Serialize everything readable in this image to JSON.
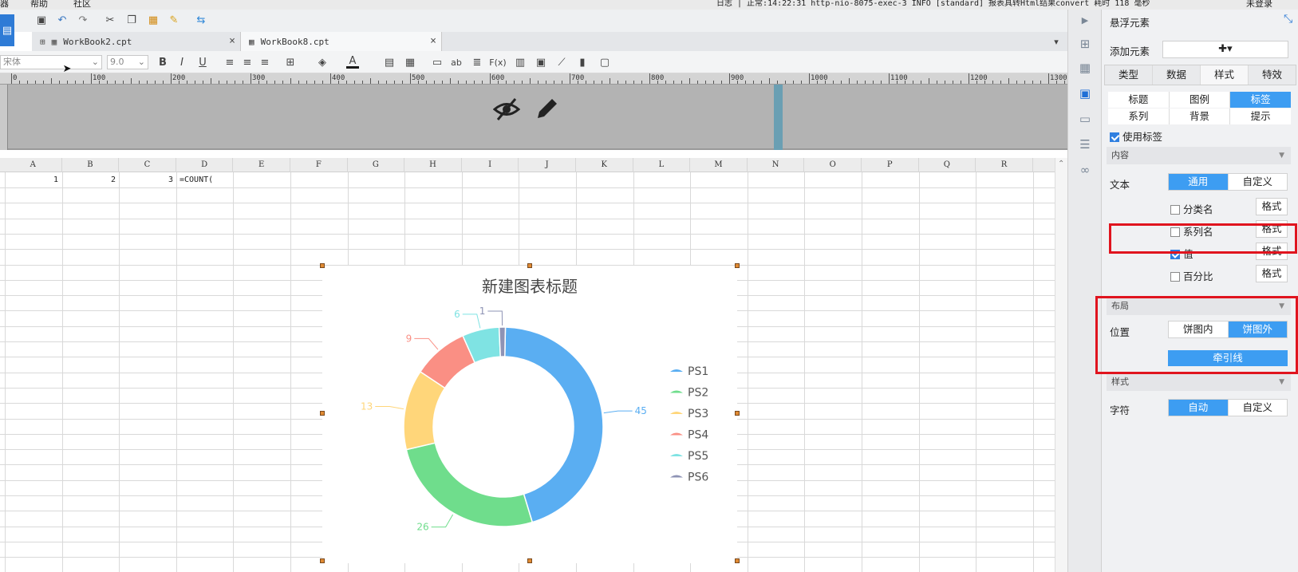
{
  "menubar": {
    "items": [
      "器",
      "帮助",
      "社区"
    ],
    "log_text": "日志 | 正常:14:22:31 http-nio-8075-exec-3 INFO [standard] 报表具转Html结果convert 耗时 118 毫秒",
    "login": "未登录"
  },
  "tabs": [
    {
      "label": "WorkBook2.cpt",
      "active": false
    },
    {
      "label": "WorkBook8.cpt",
      "active": true
    }
  ],
  "toolbar2": {
    "font_name": "宋体",
    "font_size": "9.0"
  },
  "ruler": {
    "marks": [
      "0",
      "100",
      "200",
      "300",
      "400",
      "500",
      "600",
      "700",
      "800",
      "900",
      "1000",
      "1100",
      "1200",
      "1300"
    ]
  },
  "grid": {
    "columns": [
      "A",
      "B",
      "C",
      "D",
      "E",
      "F",
      "G",
      "H",
      "I",
      "J",
      "K",
      "L",
      "M",
      "N",
      "O",
      "P",
      "Q",
      "R"
    ],
    "cells": {
      "A1": "1",
      "B1": "2",
      "C1": "3",
      "D1": "=COUNT("
    }
  },
  "chart_data": {
    "type": "pie",
    "title": "新建图表标题",
    "categories": [
      "PS1",
      "PS2",
      "PS3",
      "PS4",
      "PS5",
      "PS6"
    ],
    "values": [
      45,
      26,
      13,
      9,
      6,
      1
    ],
    "colors": [
      "#5aaef2",
      "#6fdd8c",
      "#ffd67a",
      "#fa8f84",
      "#7fe3e3",
      "#8e93b5"
    ],
    "donut": true,
    "legend_position": "right",
    "label_position": "outside-with-leader-lines"
  },
  "panel": {
    "title": "悬浮元素",
    "add_element_label": "添加元素",
    "add_symbol": "✚▾",
    "main_tabs": [
      {
        "label": "类型",
        "on": false
      },
      {
        "label": "数据",
        "on": false
      },
      {
        "label": "样式",
        "on": true
      },
      {
        "label": "特效",
        "on": false
      }
    ],
    "sub_tabs_row1": [
      {
        "label": "标题",
        "on": false
      },
      {
        "label": "图例",
        "on": false
      },
      {
        "label": "标签",
        "on": true
      }
    ],
    "sub_tabs_row2": [
      {
        "label": "系列",
        "on": false
      },
      {
        "label": "背景",
        "on": false
      },
      {
        "label": "提示",
        "on": false
      }
    ],
    "use_label": "使用标签",
    "section_content": "内容",
    "text_label": "文本",
    "text_options": [
      {
        "label": "通用",
        "on": true
      },
      {
        "label": "自定义",
        "on": false
      }
    ],
    "content_checks": [
      {
        "label": "分类名",
        "checked": false
      },
      {
        "label": "系列名",
        "checked": false
      },
      {
        "label": "值",
        "checked": true
      },
      {
        "label": "百分比",
        "checked": false
      }
    ],
    "format_label": "格式",
    "section_layout": "布局",
    "position_label": "位置",
    "position_options": [
      {
        "label": "饼图内",
        "on": false
      },
      {
        "label": "饼图外",
        "on": true
      }
    ],
    "leader_line_label": "牵引线",
    "section_style": "样式",
    "char_label": "字符",
    "char_options": [
      {
        "label": "自动",
        "on": true
      },
      {
        "label": "自定义",
        "on": false
      }
    ]
  }
}
